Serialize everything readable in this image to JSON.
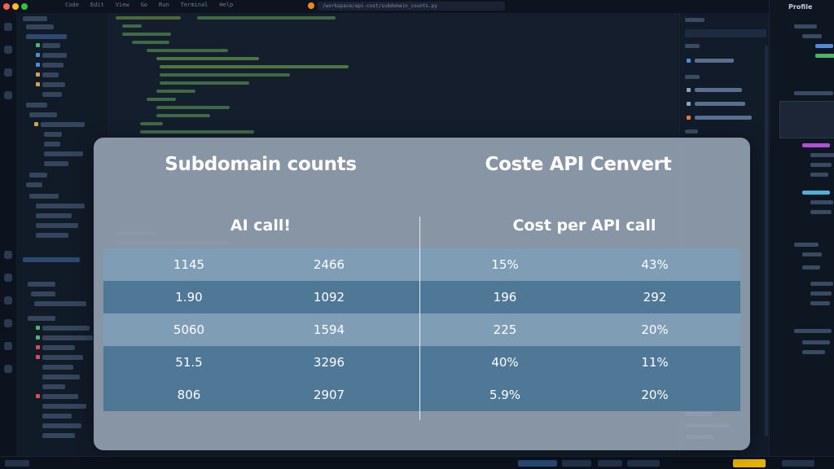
{
  "ide": {
    "tabs": [
      "Code",
      "Edit",
      "View",
      "Go",
      "Run",
      "Terminal",
      "Help"
    ],
    "path": "/workspace/api-cost/subdomain_counts.py",
    "far_right_title": "Profile"
  },
  "card": {
    "title_left": "Subdomain counts",
    "title_right": "Coste API Cenvert",
    "subtitle_left": "AI call!",
    "subtitle_right": "Cost per API call",
    "rows": [
      {
        "shade": "light",
        "c1": "1145",
        "c2": "2466",
        "c3": "15%",
        "c4": "43%"
      },
      {
        "shade": "dark",
        "c1": "1.90",
        "c2": "1092",
        "c3": "196",
        "c4": "292"
      },
      {
        "shade": "light",
        "c1": "5060",
        "c2": "1594",
        "c3": "225",
        "c4": "20%"
      },
      {
        "shade": "dark",
        "c1": "51.5",
        "c2": "3296",
        "c3": "40%",
        "c4": "11%"
      },
      {
        "shade": "dark",
        "c1": "806",
        "c2": "2907",
        "c3": "5.9%",
        "c4": "20%"
      }
    ]
  },
  "colors": {
    "accent_status": "#e6b400",
    "row_light": "#7f9db4",
    "row_dark": "#4f7896"
  }
}
